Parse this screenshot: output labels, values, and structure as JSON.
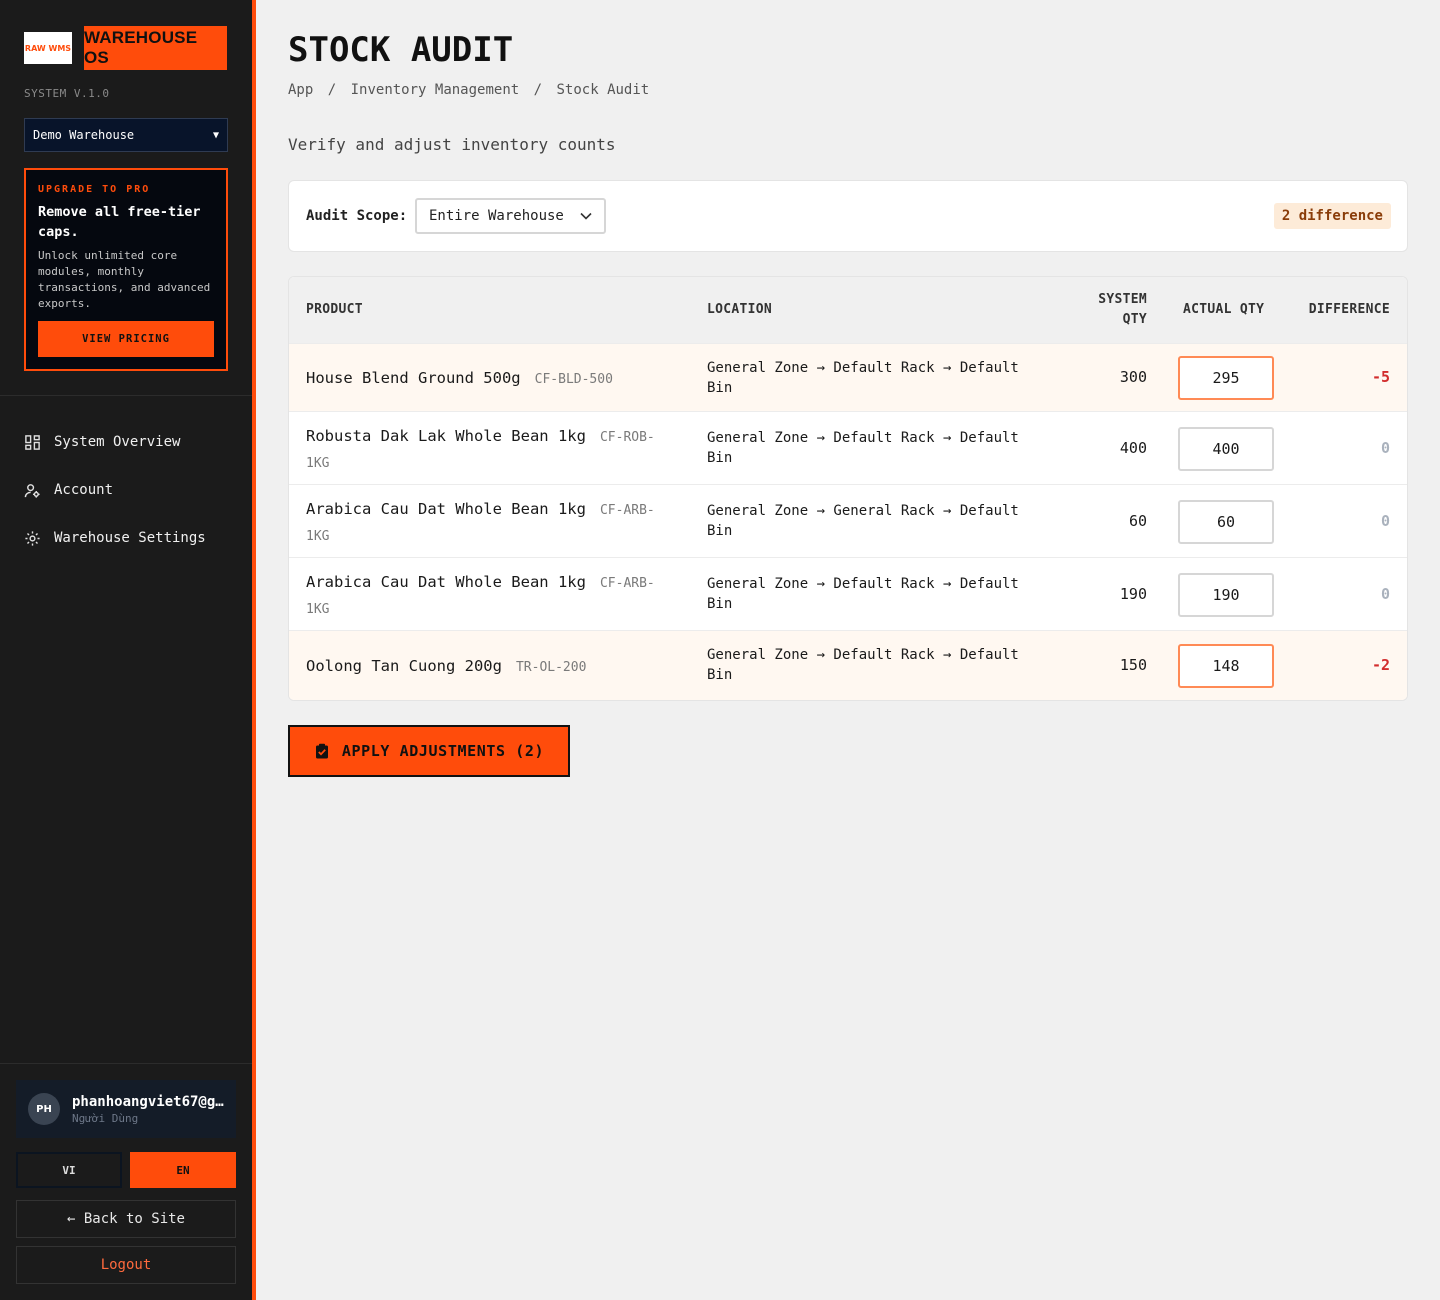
{
  "brand": {
    "logo_text": "RAW WMS",
    "title": "WAREHOUSE OS",
    "version": "SYSTEM V.1.0"
  },
  "warehouse_select": {
    "value": "Demo Warehouse"
  },
  "upgrade": {
    "kicker": "UPGRADE TO PRO",
    "title": "Remove all free-tier caps.",
    "description": "Unlock unlimited core modules, monthly transactions, and advanced exports.",
    "button": "VIEW PRICING"
  },
  "nav": [
    {
      "label": "System Overview",
      "icon": "grid-icon"
    },
    {
      "label": "Account",
      "icon": "user-cog-icon"
    },
    {
      "label": "Warehouse Settings",
      "icon": "gear-icon"
    }
  ],
  "user": {
    "initials": "PH",
    "email": "phanhoangviet67@g…",
    "role": "Người Dùng"
  },
  "lang": {
    "vi": "VI",
    "en": "EN",
    "active": "EN"
  },
  "footer": {
    "back": "← Back to Site",
    "logout": "Logout"
  },
  "page": {
    "title": "STOCK AUDIT",
    "breadcrumb": [
      "App",
      "/",
      "Inventory Management",
      "/",
      "Stock Audit"
    ],
    "subtitle": "Verify and adjust inventory counts"
  },
  "scope": {
    "label": "Audit Scope:",
    "value": "Entire Warehouse",
    "badge": "2 difference"
  },
  "table": {
    "headers": {
      "product": "PRODUCT",
      "location": "LOCATION",
      "system_qty_1": "SYSTEM",
      "system_qty_2": "QTY",
      "actual_qty": "ACTUAL QTY",
      "difference": "DIFFERENCE"
    },
    "rows": [
      {
        "name": "House Blend Ground 500g",
        "sku": "CF-BLD-500",
        "location": "General Zone → Default Rack → Default Bin",
        "system_qty": "300",
        "actual_qty": "295",
        "difference": "-5"
      },
      {
        "name": "Robusta Dak Lak Whole Bean 1kg",
        "sku": "CF-ROB-1KG",
        "location": "General Zone → Default Rack → Default Bin",
        "system_qty": "400",
        "actual_qty": "400",
        "difference": "0"
      },
      {
        "name": "Arabica Cau Dat Whole Bean 1kg",
        "sku": "CF-ARB-1KG",
        "location": "General Zone → General Rack → Default Bin",
        "system_qty": "60",
        "actual_qty": "60",
        "difference": "0"
      },
      {
        "name": "Arabica Cau Dat Whole Bean 1kg",
        "sku": "CF-ARB-1KG",
        "location": "General Zone → Default Rack → Default Bin",
        "system_qty": "190",
        "actual_qty": "190",
        "difference": "0"
      },
      {
        "name": "Oolong Tan Cuong 200g",
        "sku": "TR-OL-200",
        "location": "General Zone → Default Rack → Default Bin",
        "system_qty": "150",
        "actual_qty": "148",
        "difference": "-2"
      }
    ]
  },
  "apply_button": "APPLY ADJUSTMENTS (2)",
  "colors": {
    "accent": "#ff4c0b",
    "sidebar": "#1b1b1b",
    "negative": "#d22d2d",
    "diff_row": "#fff8f1"
  }
}
